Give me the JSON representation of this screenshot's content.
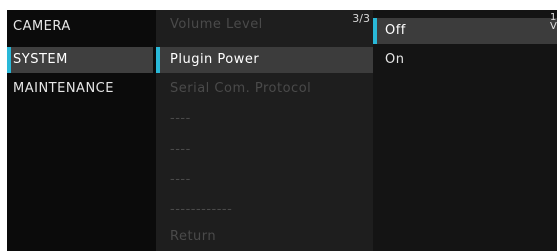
{
  "menu": {
    "main_items": [
      {
        "label": "CAMERA",
        "state": "normal"
      },
      {
        "label": "SYSTEM",
        "state": "selected"
      },
      {
        "label": "MAINTENANCE",
        "state": "normal"
      }
    ],
    "sub_items": [
      {
        "label": "Volume Level",
        "state": "dim"
      },
      {
        "label": "Plugin Power",
        "state": "selected"
      },
      {
        "label": "Serial Com. Protocol",
        "state": "dim"
      },
      {
        "label": "----",
        "state": "dim"
      },
      {
        "label": "----",
        "state": "dim"
      },
      {
        "label": "----",
        "state": "dim"
      },
      {
        "label": "------------",
        "state": "dim"
      },
      {
        "label": "Return",
        "state": "dim"
      }
    ],
    "page_indicator": "3/3",
    "options": [
      {
        "label": "Off",
        "state": "selected"
      },
      {
        "label": "On",
        "state": "normal"
      }
    ],
    "cut_off_text_line1": "1",
    "cut_off_text_line2": "V"
  },
  "colors": {
    "accent": "#29b8d8",
    "background": "#0b0b0b",
    "selected_row": "#3c3c3c",
    "dim_text": "#4a4a4a"
  }
}
